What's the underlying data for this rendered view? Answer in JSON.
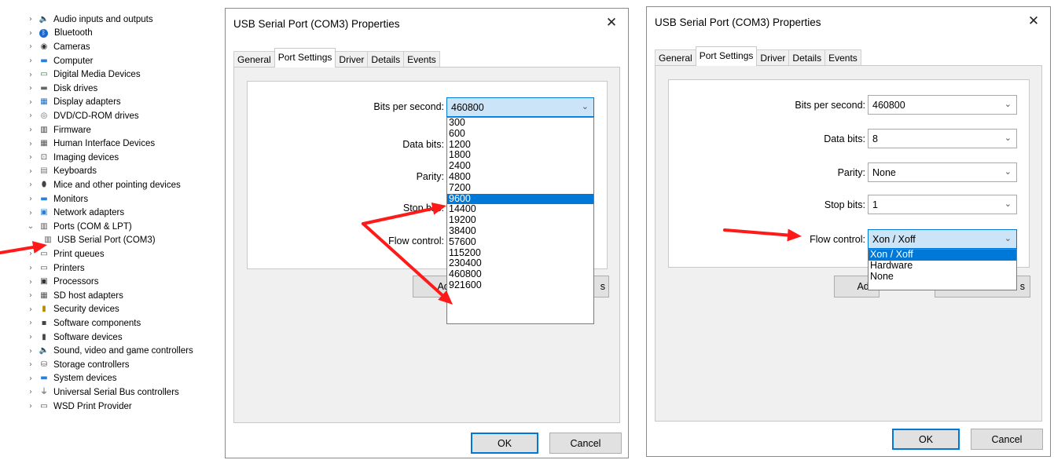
{
  "device_tree": {
    "items": [
      {
        "label": "Audio inputs and outputs",
        "icon": "speaker-icon",
        "expanded": false
      },
      {
        "label": "Bluetooth",
        "icon": "bluetooth-icon",
        "expanded": false
      },
      {
        "label": "Cameras",
        "icon": "camera-icon",
        "expanded": false
      },
      {
        "label": "Computer",
        "icon": "monitor-icon",
        "expanded": false
      },
      {
        "label": "Digital Media Devices",
        "icon": "media-device-icon",
        "expanded": false
      },
      {
        "label": "Disk drives",
        "icon": "disk-drive-icon",
        "expanded": false
      },
      {
        "label": "Display adapters",
        "icon": "display-adapter-icon",
        "expanded": false
      },
      {
        "label": "DVD/CD-ROM drives",
        "icon": "dvd-drive-icon",
        "expanded": false
      },
      {
        "label": "Firmware",
        "icon": "firmware-icon",
        "expanded": false
      },
      {
        "label": "Human Interface Devices",
        "icon": "hid-icon",
        "expanded": false
      },
      {
        "label": "Imaging devices",
        "icon": "scanner-icon",
        "expanded": false
      },
      {
        "label": "Keyboards",
        "icon": "keyboard-icon",
        "expanded": false
      },
      {
        "label": "Mice and other pointing devices",
        "icon": "mouse-icon",
        "expanded": false
      },
      {
        "label": "Monitors",
        "icon": "monitor-icon",
        "expanded": false
      },
      {
        "label": "Network adapters",
        "icon": "network-adapter-icon",
        "expanded": false
      },
      {
        "label": "Ports (COM & LPT)",
        "icon": "port-icon",
        "expanded": true
      },
      {
        "label": "USB Serial Port (COM3)",
        "icon": "port-icon",
        "child": true
      },
      {
        "label": "Print queues",
        "icon": "printer-icon",
        "expanded": false
      },
      {
        "label": "Printers",
        "icon": "printer-icon",
        "expanded": false
      },
      {
        "label": "Processors",
        "icon": "processor-icon",
        "expanded": false
      },
      {
        "label": "SD host adapters",
        "icon": "sd-card-icon",
        "expanded": false
      },
      {
        "label": "Security devices",
        "icon": "security-device-icon",
        "expanded": false
      },
      {
        "label": "Software components",
        "icon": "software-component-icon",
        "expanded": false
      },
      {
        "label": "Software devices",
        "icon": "software-device-icon",
        "expanded": false
      },
      {
        "label": "Sound, video and game controllers",
        "icon": "speaker-icon",
        "expanded": false
      },
      {
        "label": "Storage controllers",
        "icon": "storage-controller-icon",
        "expanded": false
      },
      {
        "label": "System devices",
        "icon": "system-device-icon",
        "expanded": false
      },
      {
        "label": "Universal Serial Bus controllers",
        "icon": "usb-icon",
        "expanded": false
      },
      {
        "label": "WSD Print Provider",
        "icon": "printer-icon",
        "expanded": false
      }
    ]
  },
  "dialog_left": {
    "title": "USB Serial Port (COM3) Properties",
    "close_glyph": "✕",
    "tabs": [
      "General",
      "Port Settings",
      "Driver",
      "Details",
      "Events"
    ],
    "active_tab": "Port Settings",
    "fields": {
      "bits_per_second": {
        "label": "Bits per second:",
        "value": "460800"
      },
      "data_bits": {
        "label": "Data bits:"
      },
      "parity": {
        "label": "Parity:"
      },
      "stop_bits": {
        "label": "Stop bits:"
      },
      "flow_control": {
        "label": "Flow control:"
      }
    },
    "dropdown_options": [
      "300",
      "600",
      "1200",
      "1800",
      "2400",
      "4800",
      "7200",
      "9600",
      "14400",
      "19200",
      "38400",
      "57600",
      "115200",
      "230400",
      "460800",
      "921600"
    ],
    "dropdown_highlighted": "9600",
    "advanced_button_partial": "Adv",
    "restore_button_partial": "s",
    "ok_label": "OK",
    "cancel_label": "Cancel"
  },
  "dialog_right": {
    "title": "USB Serial Port (COM3) Properties",
    "close_glyph": "✕",
    "tabs": [
      "General",
      "Port Settings",
      "Driver",
      "Details",
      "Events"
    ],
    "active_tab": "Port Settings",
    "fields": {
      "bits_per_second": {
        "label": "Bits per second:",
        "value": "460800"
      },
      "data_bits": {
        "label": "Data bits:",
        "value": "8"
      },
      "parity": {
        "label": "Parity:",
        "value": "None"
      },
      "stop_bits": {
        "label": "Stop bits:",
        "value": "1"
      },
      "flow_control": {
        "label": "Flow control:",
        "value": "Xon / Xoff"
      }
    },
    "dropdown_options": [
      "Xon / Xoff",
      "Hardware",
      "None"
    ],
    "dropdown_highlighted": "Xon / Xoff",
    "advanced_button_partial": "Adv",
    "restore_button_partial": "s",
    "ok_label": "OK",
    "cancel_label": "Cancel"
  },
  "colors": {
    "annotation_arrow": "#ff1a1a",
    "selection": "#0078d7",
    "combo_focus_bg": "#cce4f7"
  }
}
